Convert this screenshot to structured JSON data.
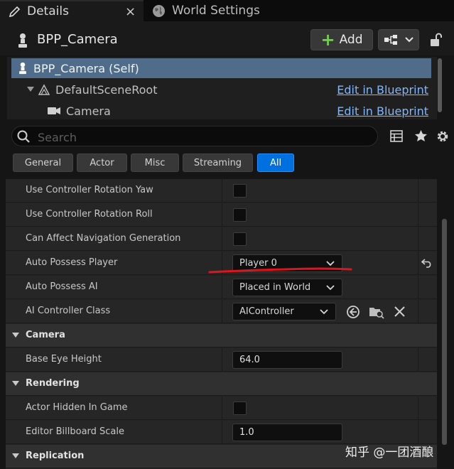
{
  "tabs": [
    {
      "label": "Details",
      "icon": "pencil-icon",
      "close": "×"
    },
    {
      "label": "World Settings",
      "icon": "globe-icon"
    }
  ],
  "header": {
    "actor_name": "BPP_Camera",
    "add_label": "Add",
    "icons": [
      "pawn-icon",
      "blueprint-icon",
      "chevron-down-icon",
      "lock-icon"
    ]
  },
  "components": [
    {
      "label": "BPP_Camera (Self)",
      "selected": true
    },
    {
      "label": "DefaultSceneRoot",
      "link": "Edit in Blueprint"
    },
    {
      "label": "Camera",
      "link": "Edit in Blueprint"
    }
  ],
  "search": {
    "placeholder": "Search"
  },
  "filter_tabs": [
    "General",
    "Actor",
    "Misc",
    "Streaming",
    "All"
  ],
  "active_filter": "All",
  "properties": {
    "use_controller_rotation_yaw": {
      "label": "Use Controller Rotation Yaw",
      "checked": false
    },
    "use_controller_rotation_roll": {
      "label": "Use Controller Rotation Roll",
      "checked": false
    },
    "can_affect_navigation_generation": {
      "label": "Can Affect Navigation Generation",
      "checked": false
    },
    "auto_possess_player": {
      "label": "Auto Possess Player",
      "value": "Player 0"
    },
    "auto_possess_ai": {
      "label": "Auto Possess AI",
      "value": "Placed in World"
    },
    "ai_controller_class": {
      "label": "AI Controller Class",
      "value": "AIController"
    },
    "camera_category": "Camera",
    "base_eye_height": {
      "label": "Base Eye Height",
      "value": "64.0"
    },
    "rendering_category": "Rendering",
    "actor_hidden_in_game": {
      "label": "Actor Hidden In Game",
      "checked": false
    },
    "editor_billboard_scale": {
      "label": "Editor Billboard Scale",
      "value": "1.0"
    },
    "replication_category": "Replication"
  },
  "watermark": "知乎 @一团酒酿",
  "colors": {
    "accent": "#0070e0",
    "link": "#7fb6ff",
    "annotation": "#e0141e",
    "add_plus": "#6fd14a"
  }
}
